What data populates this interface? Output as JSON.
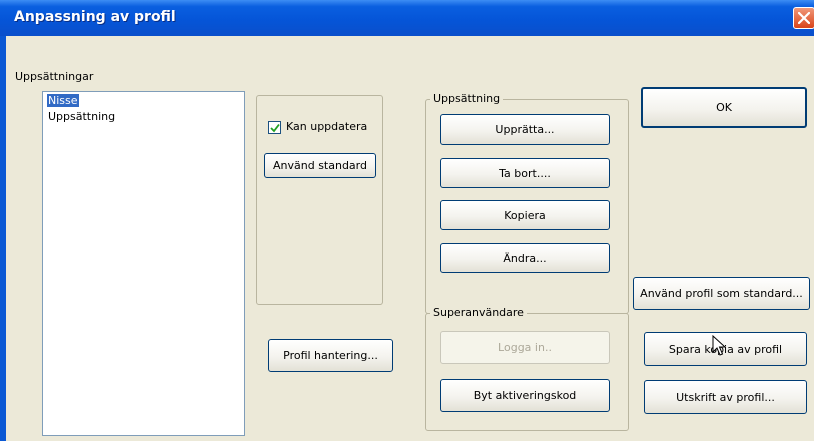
{
  "window": {
    "title": "Anpassning av profil"
  },
  "setups_list": {
    "label": "Uppsättningar",
    "items": [
      {
        "text": "Nisse",
        "selected": true
      },
      {
        "text": "Uppsättning",
        "selected": false
      }
    ]
  },
  "options": {
    "can_update_label": "Kan uppdatera",
    "can_update_checked": true,
    "use_default_label": "Använd standard",
    "profile_manage_label": "Profil hantering..."
  },
  "setup_group": {
    "legend": "Uppsättning",
    "create_label": "Upprätta...",
    "delete_label": "Ta bort....",
    "copy_label": "Kopiera",
    "edit_label": "Ändra..."
  },
  "superuser_group": {
    "legend": "Superanvändare",
    "login_label": "Logga in..",
    "change_code_label": "Byt aktiveringskod"
  },
  "right_buttons": {
    "ok_label": "OK",
    "use_profile_default_label": "Använd profil som standard...",
    "save_copy_label": "Spara kopia av profil",
    "print_label": "Utskrift av profil..."
  },
  "colors": {
    "titlebar": "#0555d8",
    "selection": "#316ac5",
    "dialog_bg": "#ece9d8",
    "close_button": "#d9441a"
  }
}
